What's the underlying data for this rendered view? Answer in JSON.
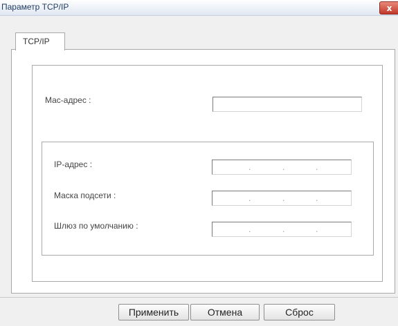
{
  "window": {
    "title": "Параметр TCP/IP",
    "close_glyph": "x"
  },
  "tabs": [
    {
      "label": "TCP/IP",
      "active": true
    }
  ],
  "fields": {
    "mac": {
      "label": "Мас-адрес :",
      "value": ""
    },
    "ip": {
      "label": "IP-адрес :",
      "value": "",
      "separators": [
        ".",
        ".",
        "."
      ]
    },
    "mask": {
      "label": "Маска подсети :",
      "value": "",
      "separators": [
        ".",
        ".",
        "."
      ]
    },
    "gateway": {
      "label": "Шлюз по умолчанию :",
      "value": "",
      "separators": [
        ".",
        ".",
        "."
      ]
    }
  },
  "buttons": {
    "apply": "Применить",
    "cancel": "Отмена",
    "reset": "Сброс"
  }
}
